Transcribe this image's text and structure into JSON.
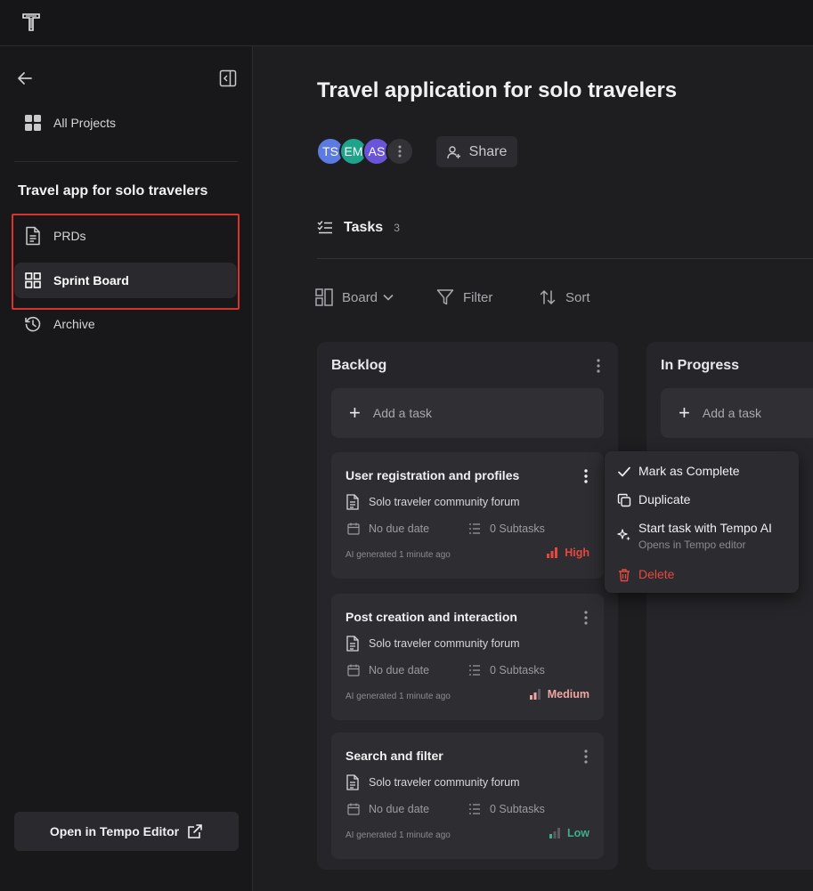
{
  "sidebar": {
    "all_projects_label": "All Projects",
    "project_name": "Travel app for solo travelers",
    "items": [
      {
        "label": "PRDs",
        "icon": "document-icon"
      },
      {
        "label": "Sprint Board",
        "icon": "grid-icon"
      },
      {
        "label": "Archive",
        "icon": "history-icon"
      }
    ],
    "open_editor_label": "Open in Tempo Editor"
  },
  "main": {
    "title": "Travel application for solo travelers",
    "avatars": [
      {
        "initials": "TS",
        "color": "#5b7be0"
      },
      {
        "initials": "EM",
        "color": "#1fa38a"
      },
      {
        "initials": "AS",
        "color": "#6a54d8"
      }
    ],
    "share_label": "Share",
    "tasks_label": "Tasks",
    "tasks_count": "3",
    "toolbar": {
      "board_label": "Board",
      "filter_label": "Filter",
      "sort_label": "Sort"
    }
  },
  "columns": [
    {
      "title": "Backlog",
      "add_task_label": "Add a task",
      "cards": [
        {
          "title": "User registration and profiles",
          "prd": "Solo traveler community forum",
          "due": "No due date",
          "subtasks": "0 Subtasks",
          "footer": "AI generated 1 minute ago",
          "priority": "High",
          "priority_color": "#e5483f"
        },
        {
          "title": "Post creation and interaction",
          "prd": "Solo traveler community forum",
          "due": "No due date",
          "subtasks": "0 Subtasks",
          "footer": "AI generated 1 minute ago",
          "priority": "Medium",
          "priority_color": "#f0a5a0"
        },
        {
          "title": "Search and filter",
          "prd": "Solo traveler community forum",
          "due": "No due date",
          "subtasks": "0 Subtasks",
          "footer": "AI generated 1 minute ago",
          "priority": "Low",
          "priority_color": "#3fae8a"
        }
      ]
    },
    {
      "title": "In Progress",
      "add_task_label": "Add a task",
      "cards": []
    }
  ],
  "context_menu": {
    "mark_complete": "Mark as Complete",
    "duplicate": "Duplicate",
    "start_task": "Start task with Tempo AI",
    "start_task_sub": "Opens in Tempo editor",
    "delete": "Delete",
    "danger_color": "#e5483f"
  }
}
